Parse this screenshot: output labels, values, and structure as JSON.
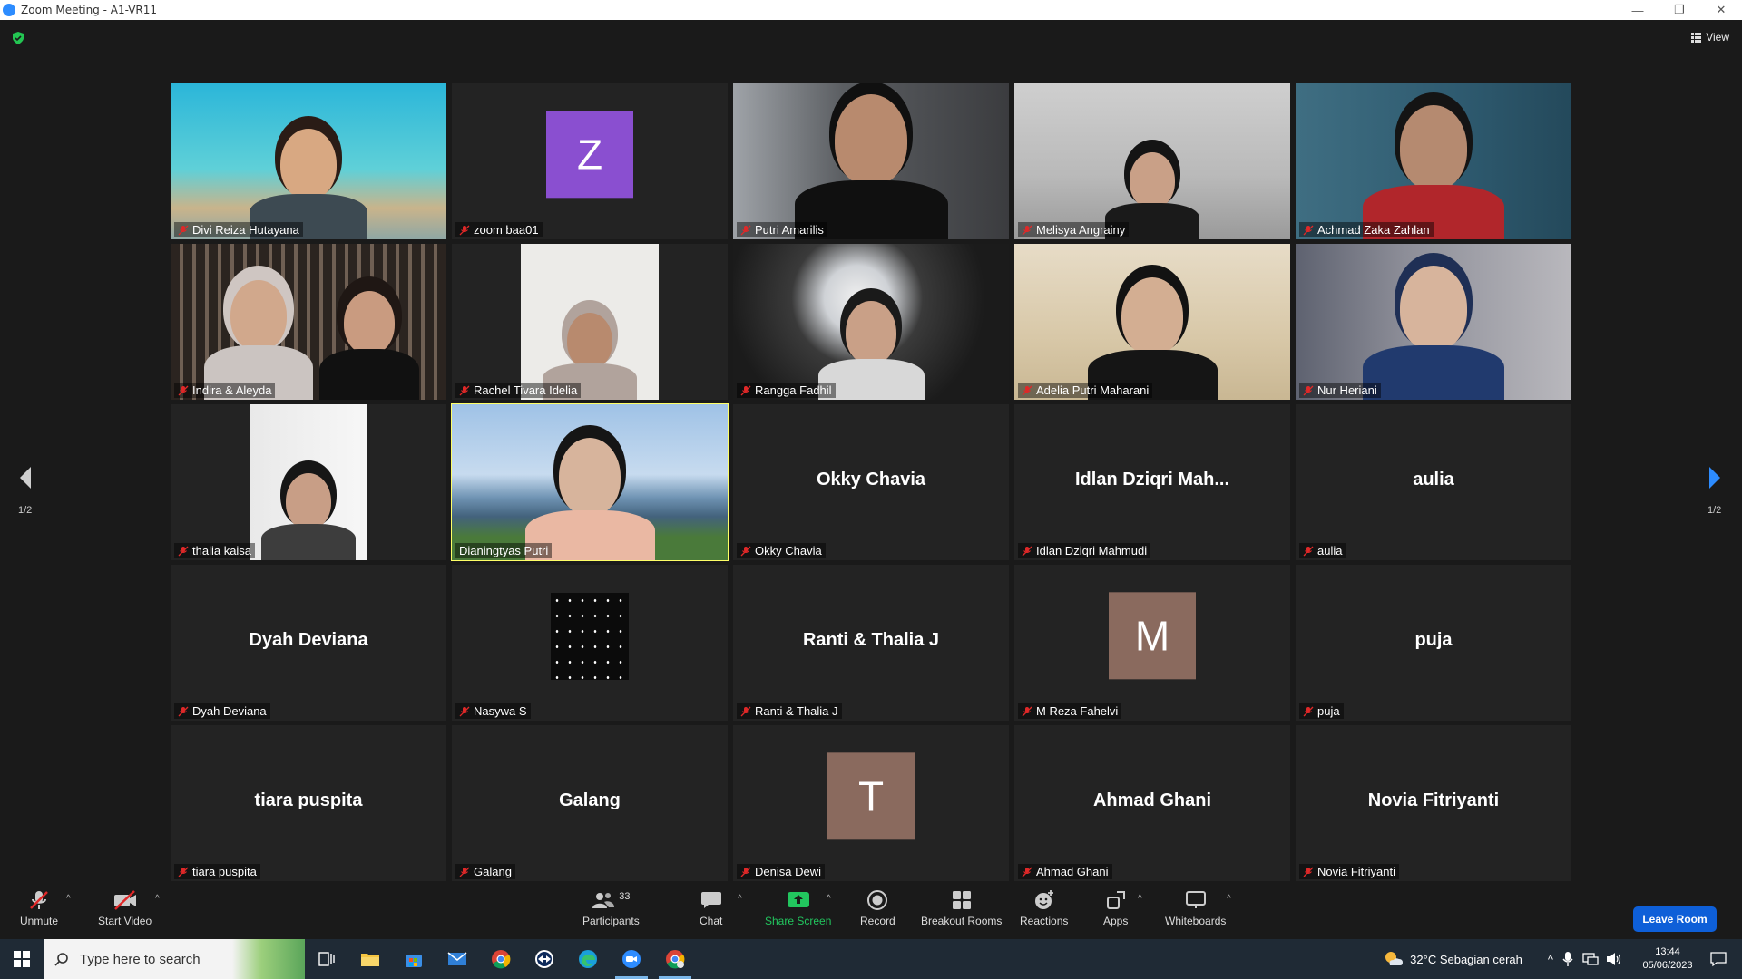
{
  "window": {
    "title": "Zoom Meeting - A1-VR11",
    "controls": [
      "minimize",
      "restore",
      "close"
    ]
  },
  "header": {
    "view_label": "View"
  },
  "pagination": {
    "left": "1/2",
    "right": "1/2"
  },
  "tiles": [
    {
      "name": "Divi Reiza Hutayana",
      "type": "video",
      "scene": "undersea"
    },
    {
      "name": "zoom baa01",
      "type": "avatar",
      "avatar_letter": "Z",
      "avatar_color": "#8a4fd0"
    },
    {
      "name": "Putri Amarilis",
      "type": "video",
      "scene": "room-dark"
    },
    {
      "name": "Melisya Angrainy",
      "type": "video",
      "scene": "grey-room"
    },
    {
      "name": "Achmad Zaka Zahlan",
      "type": "video",
      "scene": "blue-wall"
    },
    {
      "name": "Indira & Aleyda",
      "type": "video",
      "scene": "two-people"
    },
    {
      "name": "Rachel Tivara Idelia",
      "type": "video",
      "scene": "portrait-white"
    },
    {
      "name": "Rangga Fadhil",
      "type": "video",
      "scene": "ornate"
    },
    {
      "name": "Adelia Putri Maharani",
      "type": "video",
      "scene": "bedroom"
    },
    {
      "name": "Nur Heriani",
      "type": "video",
      "scene": "blue-hijab"
    },
    {
      "name": "thalia kaisa",
      "type": "video",
      "scene": "portrait-window"
    },
    {
      "name": "Dianingtyas Putri",
      "type": "video",
      "scene": "beach",
      "active": true,
      "muted": false
    },
    {
      "name": "Okky Chavia",
      "type": "text",
      "display": "Okky Chavia"
    },
    {
      "name": "Idlan Dziqri Mahmudi",
      "type": "text",
      "display": "Idlan Dziqri Mah..."
    },
    {
      "name": "aulia",
      "type": "text",
      "display": "aulia"
    },
    {
      "name": "Dyah Deviana",
      "type": "text",
      "display": "Dyah Deviana"
    },
    {
      "name": "Nasywa S",
      "type": "video",
      "scene": "stars"
    },
    {
      "name": "Ranti & Thalia J",
      "type": "text",
      "display": "Ranti & Thalia J"
    },
    {
      "name": "M Reza Fahelvi",
      "type": "avatar",
      "avatar_letter": "M",
      "avatar_color": "#8a6a5e"
    },
    {
      "name": "puja",
      "type": "text",
      "display": "puja"
    },
    {
      "name": "tiara puspita",
      "type": "text",
      "display": "tiara puspita"
    },
    {
      "name": "Galang",
      "type": "text",
      "display": "Galang"
    },
    {
      "name": "Denisa Dewi",
      "type": "avatar",
      "avatar_letter": "T",
      "avatar_color": "#8a6a5e"
    },
    {
      "name": "Ahmad Ghani",
      "type": "text",
      "display": "Ahmad Ghani"
    },
    {
      "name": "Novia Fitriyanti",
      "type": "text",
      "display": "Novia Fitriyanti"
    }
  ],
  "toolbar": {
    "unmute": "Unmute",
    "start_video": "Start Video",
    "participants": "Participants",
    "participants_count": "33",
    "chat": "Chat",
    "share_screen": "Share Screen",
    "record": "Record",
    "breakout_rooms": "Breakout Rooms",
    "reactions": "Reactions",
    "apps": "Apps",
    "whiteboards": "Whiteboards",
    "leave": "Leave Room",
    "share_color": "#22c55e"
  },
  "taskbar": {
    "search_placeholder": "Type here to search",
    "weather": "32°C  Sebagian cerah",
    "time": "13:44",
    "date": "05/06/2023"
  }
}
